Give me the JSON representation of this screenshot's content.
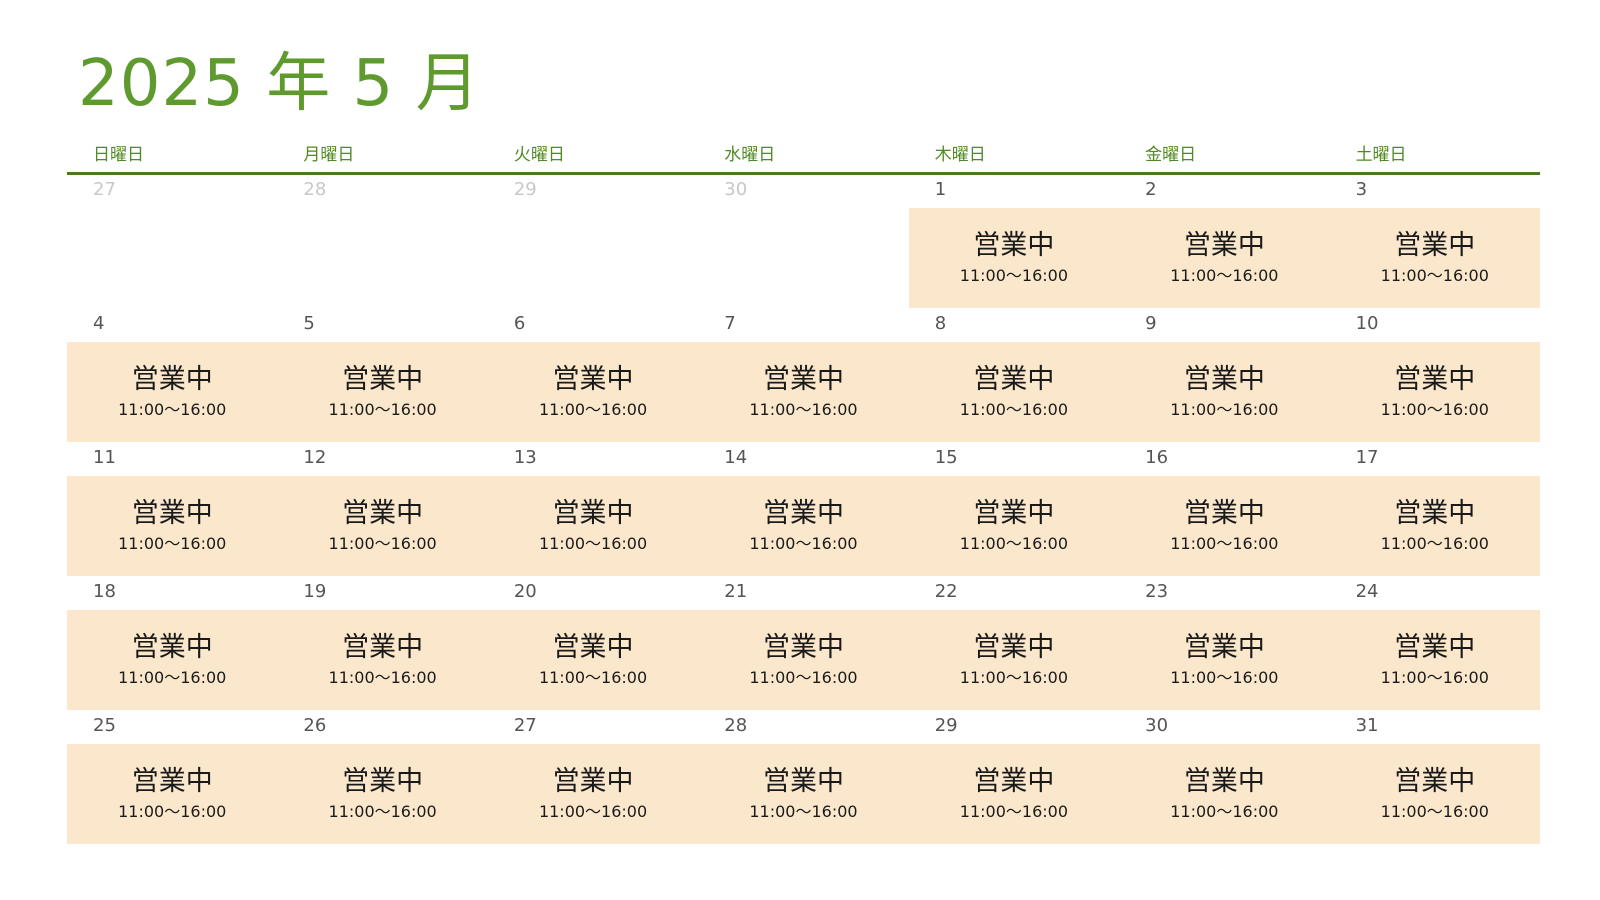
{
  "header": {
    "title": "2025 年 5 月"
  },
  "weekdays": [
    "日曜日",
    "月曜日",
    "火曜日",
    "水曜日",
    "木曜日",
    "金曜日",
    "土曜日"
  ],
  "status": {
    "label": "営業中",
    "hours": "11:00〜16:00"
  },
  "weeks": [
    [
      {
        "day": "27",
        "current": false,
        "open": false
      },
      {
        "day": "28",
        "current": false,
        "open": false
      },
      {
        "day": "29",
        "current": false,
        "open": false
      },
      {
        "day": "30",
        "current": false,
        "open": false
      },
      {
        "day": "1",
        "current": true,
        "open": true
      },
      {
        "day": "2",
        "current": true,
        "open": true
      },
      {
        "day": "3",
        "current": true,
        "open": true
      }
    ],
    [
      {
        "day": "4",
        "current": true,
        "open": true
      },
      {
        "day": "5",
        "current": true,
        "open": true
      },
      {
        "day": "6",
        "current": true,
        "open": true
      },
      {
        "day": "7",
        "current": true,
        "open": true
      },
      {
        "day": "8",
        "current": true,
        "open": true
      },
      {
        "day": "9",
        "current": true,
        "open": true
      },
      {
        "day": "10",
        "current": true,
        "open": true
      }
    ],
    [
      {
        "day": "11",
        "current": true,
        "open": true
      },
      {
        "day": "12",
        "current": true,
        "open": true
      },
      {
        "day": "13",
        "current": true,
        "open": true
      },
      {
        "day": "14",
        "current": true,
        "open": true
      },
      {
        "day": "15",
        "current": true,
        "open": true
      },
      {
        "day": "16",
        "current": true,
        "open": true
      },
      {
        "day": "17",
        "current": true,
        "open": true
      }
    ],
    [
      {
        "day": "18",
        "current": true,
        "open": true
      },
      {
        "day": "19",
        "current": true,
        "open": true
      },
      {
        "day": "20",
        "current": true,
        "open": true
      },
      {
        "day": "21",
        "current": true,
        "open": true
      },
      {
        "day": "22",
        "current": true,
        "open": true
      },
      {
        "day": "23",
        "current": true,
        "open": true
      },
      {
        "day": "24",
        "current": true,
        "open": true
      }
    ],
    [
      {
        "day": "25",
        "current": true,
        "open": true
      },
      {
        "day": "26",
        "current": true,
        "open": true
      },
      {
        "day": "27",
        "current": true,
        "open": true
      },
      {
        "day": "28",
        "current": true,
        "open": true
      },
      {
        "day": "29",
        "current": true,
        "open": true
      },
      {
        "day": "30",
        "current": true,
        "open": true
      },
      {
        "day": "31",
        "current": true,
        "open": true
      }
    ]
  ]
}
